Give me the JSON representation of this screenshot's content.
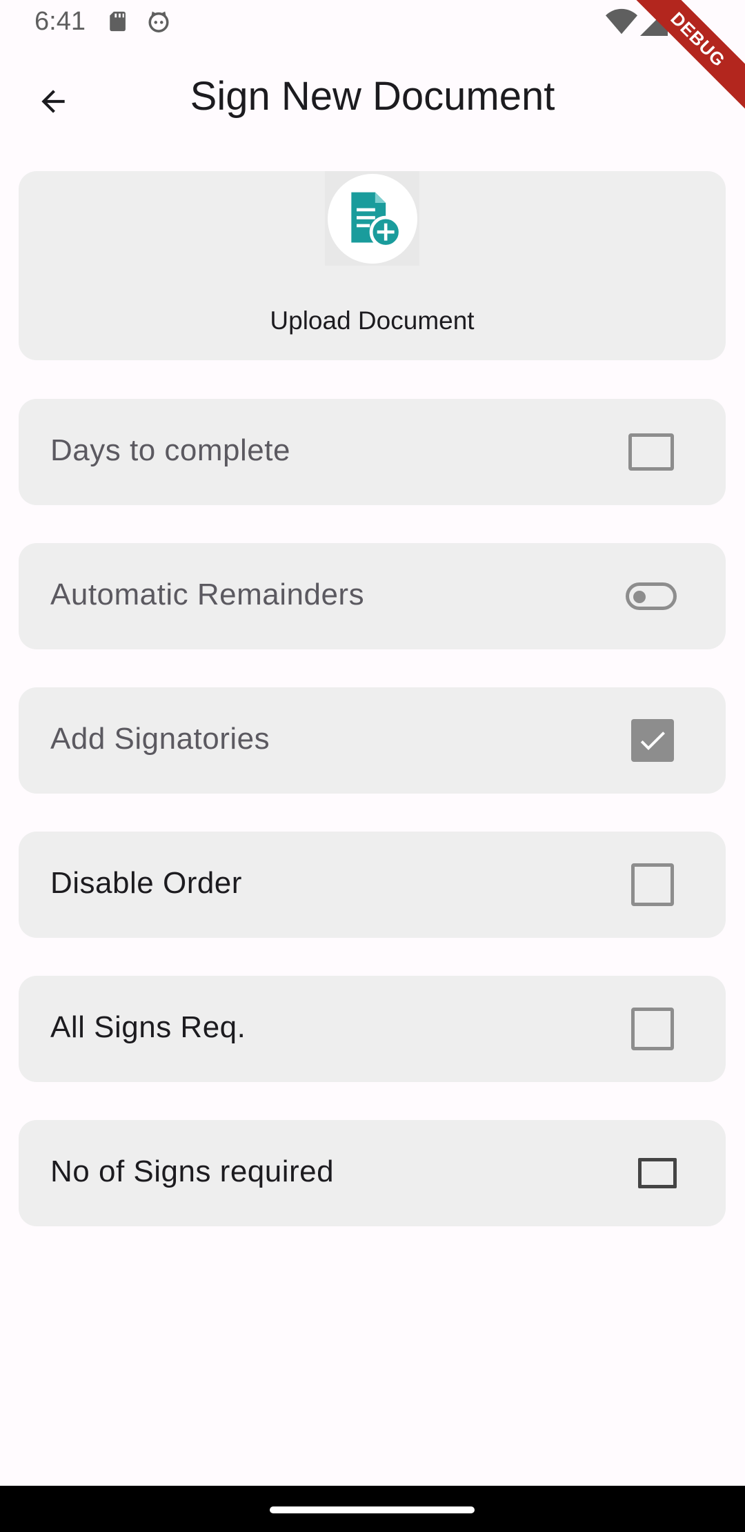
{
  "status_bar": {
    "time": "6:41"
  },
  "debug_banner": "DEBUG",
  "app_bar": {
    "title": "Sign New Document"
  },
  "upload": {
    "label": "Upload Document",
    "icon": "document-add-icon",
    "accent": "#1a9c9c"
  },
  "options": [
    {
      "label": "Days to complete",
      "control": "checkbox",
      "checked": false,
      "enabled": false
    },
    {
      "label": "Automatic Remainders",
      "control": "switch",
      "checked": false,
      "enabled": false
    },
    {
      "label": "Add Signatories",
      "control": "checkbox",
      "checked": true,
      "enabled": false
    },
    {
      "label": "Disable Order",
      "control": "checkbox",
      "checked": false,
      "enabled": true
    },
    {
      "label": "All Signs Req.",
      "control": "checkbox",
      "checked": false,
      "enabled": true
    },
    {
      "label": "No of Signs required",
      "control": "checkbox",
      "checked": false,
      "enabled": true
    }
  ],
  "colors": {
    "background": "#fffbfe",
    "card": "#eeeeee",
    "disabled_control": "#8d8d8d",
    "debug_ribbon": "#b3261e"
  }
}
